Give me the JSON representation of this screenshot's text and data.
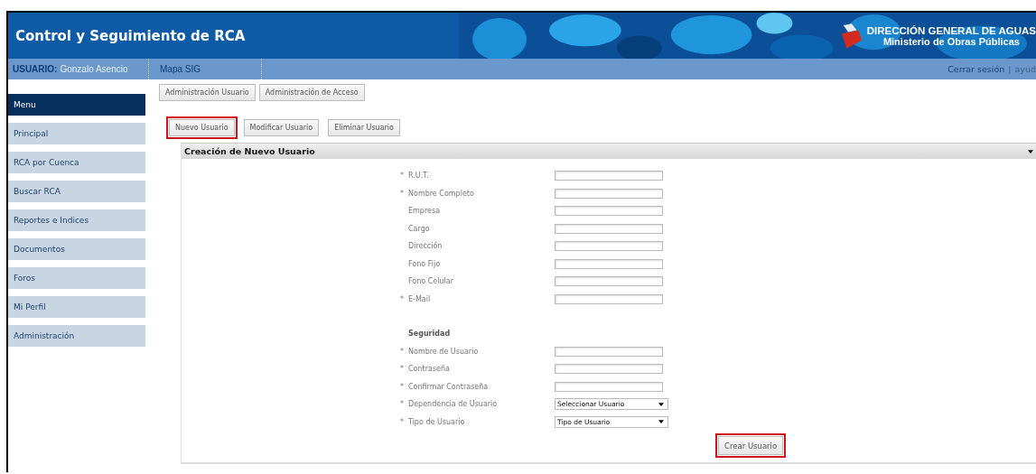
{
  "header": {
    "title": "Control y Seguimiento de RCA",
    "org": "DIRECCIÓN GENERAL DE AGUAS",
    "ministry": "Ministerio de Obras Públicas"
  },
  "navbar": {
    "user_label": "USUARIO:",
    "user_name": "Gonzalo Asencio",
    "link": "Mapa SIG",
    "logout": "Cerrar sesión",
    "separator": "|",
    "help": "ayud"
  },
  "sidebar": {
    "heading": "Menu",
    "items": [
      "Principal",
      "RCA por Cuenca",
      "Buscar RCA",
      "Reportes e Indices",
      "Documentos",
      "Foros",
      "Mi Perfil",
      "Administración"
    ]
  },
  "tabs": [
    {
      "label": "Administración Usuario"
    },
    {
      "label": "Administración de Acceso"
    }
  ],
  "actions": [
    {
      "label": "Nuevo Usuario",
      "highlighted": true
    },
    {
      "label": "Modificar Usuario",
      "highlighted": false
    },
    {
      "label": "Eliminar Usuario",
      "highlighted": false
    }
  ],
  "panel": {
    "title": "Creación de Nuevo Usuario",
    "fields": [
      {
        "kind": "text",
        "mark": "*",
        "label": "R.U.T."
      },
      {
        "kind": "text",
        "mark": "*",
        "label": "Nombre Completo"
      },
      {
        "kind": "text",
        "label": "Empresa"
      },
      {
        "kind": "text",
        "label": "Cargo"
      },
      {
        "kind": "text",
        "label": "Dirección"
      },
      {
        "kind": "text",
        "label": "Fono Fijo"
      },
      {
        "kind": "text",
        "label": "Fono Celular"
      },
      {
        "kind": "text",
        "mark": "*",
        "label": "E-Mail"
      },
      {
        "kind": "section",
        "label": "Seguridad"
      },
      {
        "kind": "text",
        "mark": "*",
        "label": "Nombre de Usuario"
      },
      {
        "kind": "text",
        "mark": "*",
        "label": "Contraseña"
      },
      {
        "kind": "text",
        "mark": "*",
        "label": "Confirmar Contraseña"
      },
      {
        "kind": "select",
        "mark": "*",
        "label": "Dependencia de Usuario",
        "value": "Seleccionar Usuario"
      },
      {
        "kind": "select",
        "mark": "*",
        "label": "Tipo de Usuario",
        "value": "Tipo de Usuario"
      }
    ],
    "submit": {
      "label": "Crear Usuario",
      "highlighted": true
    }
  }
}
